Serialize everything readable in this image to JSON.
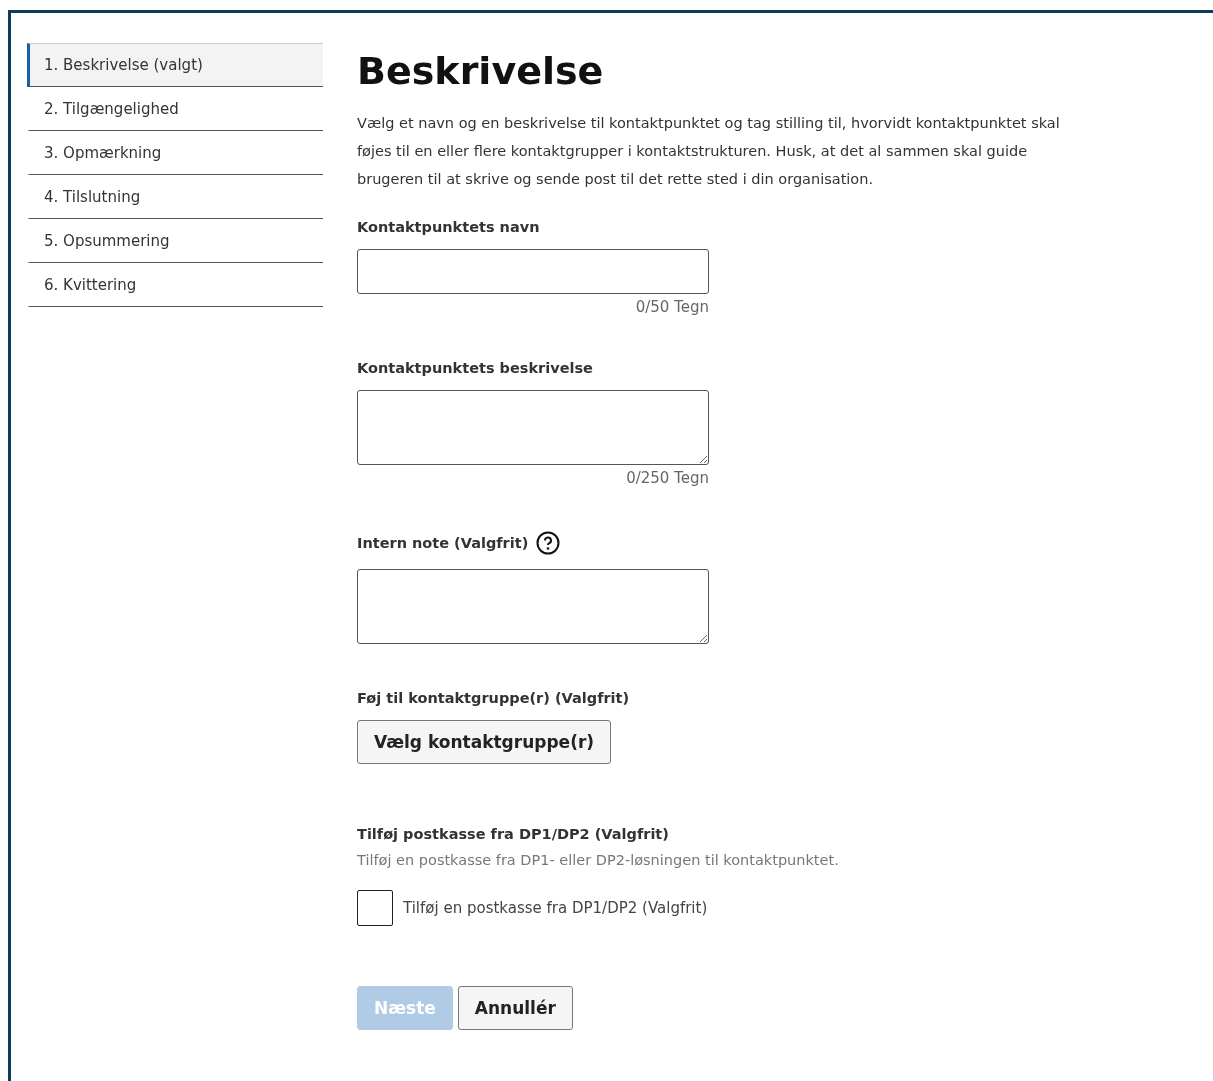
{
  "steps": [
    {
      "label": "1. Beskrivelse (valgt)",
      "selected": true
    },
    {
      "label": "2. Tilgængelighed",
      "selected": false
    },
    {
      "label": "3. Opmærkning",
      "selected": false
    },
    {
      "label": "4. Tilslutning",
      "selected": false
    },
    {
      "label": "5. Opsummering",
      "selected": false
    },
    {
      "label": "6. Kvittering",
      "selected": false
    }
  ],
  "heading": "Beskrivelse",
  "intro": "Vælg et navn og en beskrivelse til kontaktpunktet og tag stilling til, hvorvidt kontaktpunktet skal føjes til en eller flere kontaktgrupper i kontaktstrukturen. Husk, at det al sammen skal guide brugeren til at skrive og sende post til det rette sted i din organisation.",
  "fields": [
    {
      "kind": "input",
      "label": "Kontaktpunktets navn",
      "counter": "0/50 Tegn"
    },
    {
      "kind": "textarea",
      "label": "Kontaktpunktets beskrivelse",
      "counter": "0/250 Tegn"
    },
    {
      "kind": "textarea",
      "label": "Intern note (Valgfrit)",
      "help": true
    }
  ],
  "group": {
    "label": "Føj til kontaktgruppe(r) (Valgfrit)",
    "button": "Vælg kontaktgruppe(r)"
  },
  "mailbox": {
    "label": "Tilføj postkasse fra DP1/DP2 (Valgfrit)",
    "hint": "Tilføj en postkasse fra DP1- eller DP2-løsningen til kontaktpunktet.",
    "checkbox": {
      "label": "Tilføj en postkasse fra DP1/DP2 (Valgfrit)",
      "checked": false
    }
  },
  "actions": [
    {
      "label": "Næste",
      "kind": "primary",
      "disabled": true
    },
    {
      "label": "Annullér",
      "kind": "secondary",
      "disabled": false
    }
  ]
}
